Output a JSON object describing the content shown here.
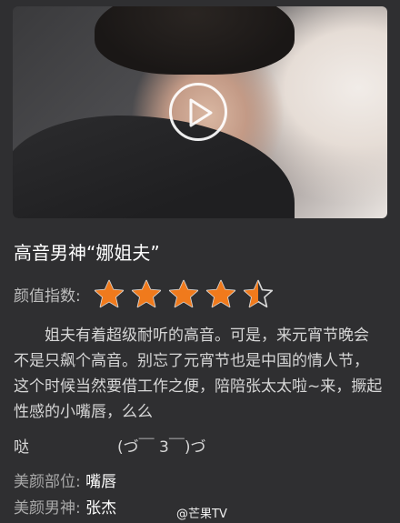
{
  "video": {
    "title": "高音男神“娜姐夫”",
    "play_icon": "play-icon"
  },
  "rating": {
    "label": "颜值指数:",
    "value": 4.5,
    "max": 5,
    "star_color": "#f07a1c"
  },
  "description": {
    "text": "姐夫有着超级耐听的高音。可是，来元宵节晚会不是只飙个高音。别忘了元宵节也是中国的情人节，这个时候当然要借工作之便，陪陪张太太啦~来，撅起性感的小嘴唇，么么",
    "tail_word": "哒",
    "emoticon": "(づ￣ 3￣)づ"
  },
  "info": [
    {
      "label": "美颜部位: ",
      "value": "嘴唇"
    },
    {
      "label": "美颜男神: ",
      "value": "张杰"
    }
  ],
  "watermark": "@芒果TV"
}
